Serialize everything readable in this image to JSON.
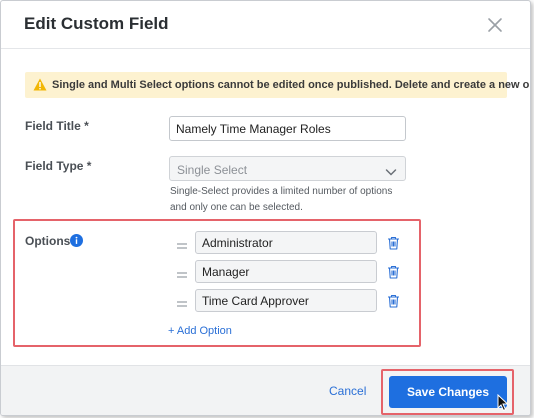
{
  "modal": {
    "title": "Edit Custom Field",
    "close_icon": "close-icon"
  },
  "banner": {
    "icon": "warning-icon",
    "text": "Single and Multi Select options cannot be edited once published. Delete and create a new one."
  },
  "field_title": {
    "label": "Field Title *",
    "value": "Namely Time Manager Roles"
  },
  "field_type": {
    "label": "Field Type *",
    "value": "Single Select",
    "help_line1": "Single-Select provides a limited number of options",
    "help_line2": "and only one can be selected."
  },
  "options": {
    "label": "Options",
    "items": [
      {
        "value": "Administrator"
      },
      {
        "value": "Manager"
      },
      {
        "value": "Time Card Approver"
      }
    ],
    "add_label": "+ Add Option"
  },
  "footer": {
    "cancel_label": "Cancel",
    "save_label": "Save Changes"
  },
  "colors": {
    "primary": "#1e6fe0",
    "link": "#2a6fd6",
    "highlight": "#e5636a",
    "warning_bg": "#fdf2d0",
    "warning_icon": "#f2b705"
  }
}
